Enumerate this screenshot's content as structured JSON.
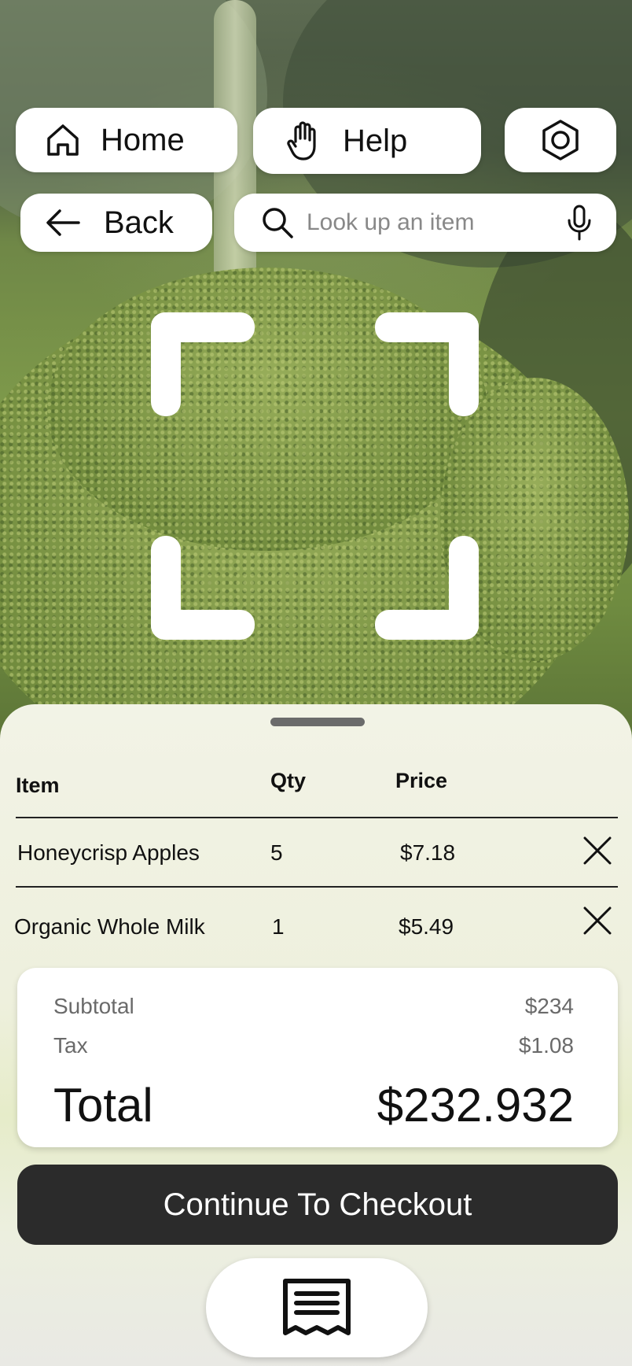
{
  "nav": {
    "home_label": "Home",
    "help_label": "Help",
    "back_label": "Back"
  },
  "search": {
    "placeholder": "Look up an item"
  },
  "cart": {
    "headers": {
      "item": "Item",
      "qty": "Qty",
      "price": "Price"
    },
    "rows": [
      {
        "item": "Honeycrisp Apples",
        "qty": "5",
        "price": "$7.18"
      },
      {
        "item": "Organic Whole Milk",
        "qty": "1",
        "price": "$5.49"
      }
    ]
  },
  "summary": {
    "subtotal_label": "Subtotal",
    "subtotal_value": "$234",
    "tax_label": "Tax",
    "tax_value": "$1.08",
    "total_label": "Total",
    "total_value": "$232.932"
  },
  "checkout_label": "Continue To Checkout",
  "icons": {
    "home": "home-icon",
    "help": "raised-hand-icon",
    "settings": "hexagon-settings-icon",
    "back": "arrow-left-icon",
    "search": "search-icon",
    "mic": "microphone-icon",
    "remove": "close-icon",
    "receipt": "receipt-icon"
  },
  "colors": {
    "checkout_bg": "#2b2b2b",
    "sheet_bg": "#f2f3e6"
  }
}
